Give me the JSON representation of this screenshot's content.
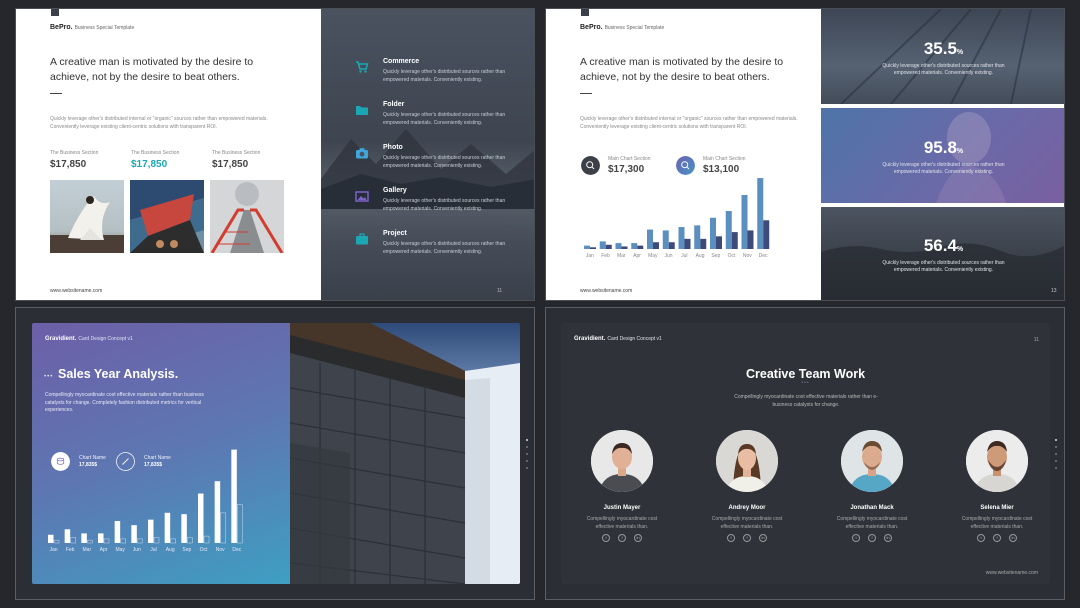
{
  "slide1": {
    "brand": "BePro.",
    "brand_sub": "Business Special Template",
    "quote": "A creative man is motivated by the desire to achieve, not by the desire to beat others.",
    "paragraph": "Quickly leverage other's distributed internal or \"organic\" sources rather than empowered materials. Conveniently leverage existing client-centric solutions with transparent ROI.",
    "stats": [
      {
        "label": "The Business Section",
        "value": "$17,850"
      },
      {
        "label": "The Business Section",
        "value": "$17,850"
      },
      {
        "label": "The Business Section",
        "value": "$17,850"
      }
    ],
    "website": "www.websitename.com",
    "page": "11",
    "features": [
      {
        "icon": "cart-icon",
        "title": "Commerce",
        "desc": "Quickly leverage other's distributed sources rather than empowered materials. Conveniently existing."
      },
      {
        "icon": "folder-icon",
        "title": "Folder",
        "desc": "Quickly leverage other's distributed sources rather than empowered materials. Conveniently existing."
      },
      {
        "icon": "camera-icon",
        "title": "Photo",
        "desc": "Quickly leverage other's distributed sources rather than empowered materials. Conveniently existing."
      },
      {
        "icon": "gallery-icon",
        "title": "Gallery",
        "desc": "Quickly leverage other's distributed sources rather than empowered materials. Conveniently existing."
      },
      {
        "icon": "briefcase-icon",
        "title": "Project",
        "desc": "Quickly leverage other's distributed sources rather than empowered materials. Conveniently existing."
      }
    ],
    "accent": "#1aa9b4"
  },
  "slide2": {
    "brand": "BePro.",
    "brand_sub": "Business Special Template",
    "quote": "A creative man is motivated by the desire to achieve, not by the desire to beat others.",
    "paragraph": "Quickly leverage other's distributed internal or \"organic\" sources rather than empowered materials. Conveniently leverage existing client-centric solutions with transparent ROI.",
    "stats": [
      {
        "label": "Main Chart Section",
        "value": "$17,300"
      },
      {
        "label": "Main Chart Section",
        "value": "$13,100"
      }
    ],
    "website": "www.websitename.com",
    "page": "13",
    "panels": [
      {
        "value": "35.5",
        "unit": "%",
        "desc": "Quickly leverage other's distributed sources rather than empowered materials. Conveniently existing."
      },
      {
        "value": "95.8",
        "unit": "%",
        "desc": "Quickly leverage other's distributed sources rather than empowered materials. Conveniently existing."
      },
      {
        "value": "56.4",
        "unit": "%",
        "desc": "Quickly leverage other's distributed sources rather than empowered materials. Conveniently existing."
      }
    ]
  },
  "slide3": {
    "brand": "Gravidient.",
    "brand_sub": "Card Design Concept v1",
    "title": "Sales Year Analysis.",
    "desc": "Compellingly myocardinate cost effective materials rather than business catalysts for change. Completely fashion distributed metrics for vertical experiences.",
    "stats": [
      {
        "label": "Chart Name",
        "value": "17,835$"
      },
      {
        "label": "Chart Name",
        "value": "17,835$"
      }
    ]
  },
  "slide4": {
    "brand": "Gravidient.",
    "brand_sub": "Card Design Concept v1",
    "page": "11",
    "title": "Creative Team Work",
    "desc": "Compellingly myocardinate cost effective materials rather than e-business catalysts for change.",
    "website": "www.websitename.com",
    "members": [
      {
        "name": "Justin Mayer",
        "desc": "Compellingly myocardinate cost effective materials than."
      },
      {
        "name": "Andrey Moor",
        "desc": "Compellingly myocardinate cost effective materials than."
      },
      {
        "name": "Jonathan Mack",
        "desc": "Compellingly myocardinate cost effective materials than."
      },
      {
        "name": "Selena Mier",
        "desc": "Compellingly myocardinate cost effective materials than."
      }
    ]
  },
  "chart_data": [
    {
      "type": "bar",
      "categories": [
        "Jan",
        "Feb",
        "Mar",
        "Apr",
        "May",
        "Jun",
        "Jul",
        "Aug",
        "Sep",
        "Oct",
        "Nov",
        "Dec"
      ],
      "series": [
        {
          "values": [
            4,
            9,
            7,
            7,
            23,
            22,
            26,
            28,
            37,
            45,
            64,
            84
          ]
        },
        {
          "values": [
            2,
            5,
            3,
            4,
            8,
            8,
            12,
            12,
            15,
            20,
            22,
            34
          ]
        }
      ],
      "ylim": [
        0,
        90
      ],
      "colors": [
        "#5b8fbf",
        "#3e4a7a"
      ]
    },
    {
      "type": "bar",
      "categories": [
        "Jan",
        "Feb",
        "Mar",
        "Apr",
        "May",
        "Jun",
        "Jul",
        "Aug",
        "Sep",
        "Oct",
        "Nov",
        "Dec"
      ],
      "series": [
        {
          "values": [
            6,
            10,
            7,
            7,
            16,
            13,
            17,
            22,
            21,
            36,
            45,
            68
          ]
        },
        {
          "values": [
            2,
            4,
            2,
            3,
            3,
            3,
            4,
            3,
            4,
            5,
            22,
            28
          ]
        }
      ],
      "ylim": [
        0,
        75
      ],
      "colors": [
        "#ffffff",
        "rgba(255,255,255,0.5)"
      ]
    }
  ]
}
